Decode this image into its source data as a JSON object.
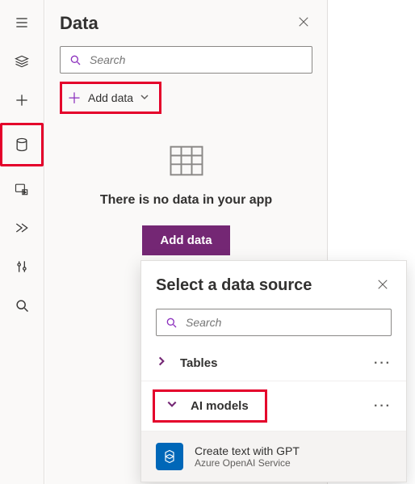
{
  "panel": {
    "title": "Data",
    "search_placeholder": "Search",
    "add_data_pill": "Add data",
    "empty_message": "There is no data in your app",
    "add_data_button": "Add data"
  },
  "popup": {
    "title": "Select a data source",
    "search_placeholder": "Search",
    "categories": {
      "tables": "Tables",
      "ai_models": "AI models"
    },
    "item": {
      "title": "Create text with GPT",
      "subtitle": "Azure OpenAI Service"
    }
  },
  "icons": {
    "hamburger": "hamburger-icon",
    "layers": "layers-icon",
    "plus": "plus-icon",
    "database": "database-icon",
    "media": "media-icon",
    "flow": "flow-icon",
    "tools": "tools-icon",
    "search_rail": "search-icon"
  }
}
